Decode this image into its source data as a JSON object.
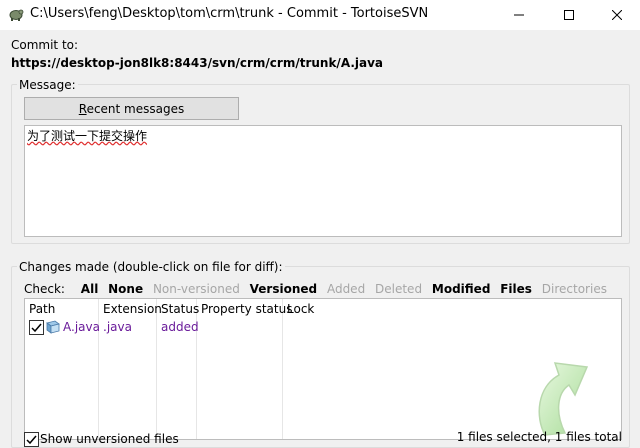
{
  "window": {
    "title": "C:\\Users\\feng\\Desktop\\tom\\crm\\trunk - Commit - TortoiseSVN",
    "app_icon": "tortoisesvn-icon"
  },
  "commit": {
    "label": "Commit to:",
    "url": "https://desktop-jon8lk8:8443/svn/crm/crm/trunk/A.java"
  },
  "message": {
    "label": "Message:",
    "recent_button_prefix": "",
    "recent_button_underlined": "R",
    "recent_button_rest": "ecent messages",
    "text": "为了测试一下提交操作"
  },
  "changes": {
    "label": "Changes made (double-click on file for diff):",
    "check_label": "Check:",
    "filters": [
      {
        "label": "All",
        "state": "active"
      },
      {
        "label": "None",
        "state": "active"
      },
      {
        "label": "Non-versioned",
        "state": "inactive"
      },
      {
        "label": "Versioned",
        "state": "active"
      },
      {
        "label": "Added",
        "state": "inactive"
      },
      {
        "label": "Deleted",
        "state": "inactive"
      },
      {
        "label": "Modified",
        "state": "active"
      },
      {
        "label": "Files",
        "state": "active"
      },
      {
        "label": "Directories",
        "state": "inactive"
      }
    ],
    "columns": [
      "Path",
      "Extension",
      "Status",
      "Property status",
      "Lock"
    ],
    "rows": [
      {
        "checked": true,
        "path": "A.java",
        "extension": ".java",
        "status": "added",
        "property_status": "",
        "lock": ""
      }
    ],
    "row_color": "#6a1b9a"
  },
  "footer": {
    "show_unversioned_label": "Show unversioned files",
    "show_unversioned_checked": true,
    "status_text": "1 files selected, 1 files total"
  }
}
